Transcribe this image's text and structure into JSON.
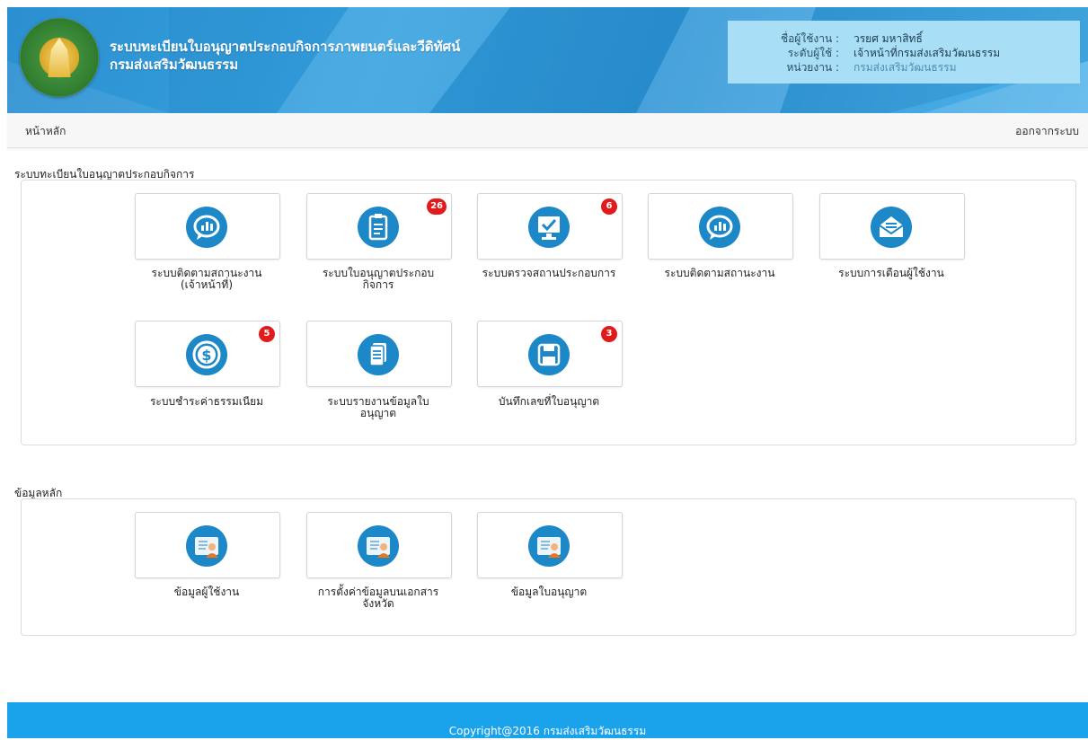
{
  "header": {
    "title_line1": "ระบบทะเบียนใบอนุญาตประกอบกิจการภาพยนตร์และวีดิทัศน์",
    "title_line2": "กรมส่งเสริมวัฒนธรรม",
    "user": {
      "name_label": "ชื่อผู้ใช้งาน :",
      "name_value": "วรยศ มหาสิทธิ์",
      "level_label": "ระดับผู้ใช้ :",
      "level_value": "เจ้าหน้าที่กรมส่งเสริมวัฒนธรรม",
      "unit_label": "หน่วยงาน :",
      "unit_value": "กรมส่งเสริมวัฒนธรรม"
    }
  },
  "nav": {
    "home": "หน้าหลัก",
    "logout": "ออกจากระบบ"
  },
  "section1": {
    "title": "ระบบทะเบียนใบอนุญาตประกอบกิจการ",
    "tiles": [
      {
        "icon": "chat-chart-icon",
        "label1": "ระบบติดตามสถานะงาน",
        "label2": "(เจ้าหน้าที่)",
        "badge": ""
      },
      {
        "icon": "clipboard-icon",
        "label1": "ระบบใบอนุญาตประกอบ",
        "label2": "กิจการ",
        "badge": "26"
      },
      {
        "icon": "monitor-check-icon",
        "label1": "ระบบตรวจสถานประกอบการ",
        "label2": "",
        "badge": "6"
      },
      {
        "icon": "chat-chart-icon",
        "label1": "ระบบติดตามสถานะงาน",
        "label2": "",
        "badge": ""
      },
      {
        "icon": "envelope-icon",
        "label1": "ระบบการเตือนผู้ใช้งาน",
        "label2": "",
        "badge": ""
      },
      {
        "icon": "dollar-icon",
        "label1": "ระบบชำระค่าธรรมเนียม",
        "label2": "",
        "badge": "5"
      },
      {
        "icon": "document-icon",
        "label1": "ระบบรายงานข้อมูลใบ",
        "label2": "อนุญาต",
        "badge": ""
      },
      {
        "icon": "save-icon",
        "label1": "บันทึกเลขที่ใบอนุญาต",
        "label2": "",
        "badge": "3"
      }
    ]
  },
  "section2": {
    "title": "ข้อมูลหลัก",
    "tiles": [
      {
        "icon": "user-card-icon",
        "label1": "ข้อมูลผู้ใช้งาน",
        "label2": ""
      },
      {
        "icon": "user-card-icon",
        "label1": "การตั้งค่าข้อมูลบนเอกสาร",
        "label2": "จังหวัด"
      },
      {
        "icon": "user-card-icon",
        "label1": "ข้อมูลใบอนุญาต",
        "label2": ""
      }
    ]
  },
  "footer": {
    "text": "Copyright@2016 กรมส่งเสริมวัฒนธรรม"
  },
  "colors": {
    "header_blue": "#2f95d6",
    "icon_blue": "#1c88c8",
    "badge_red": "#e01b1b",
    "footer_blue": "#1aa2ea"
  }
}
